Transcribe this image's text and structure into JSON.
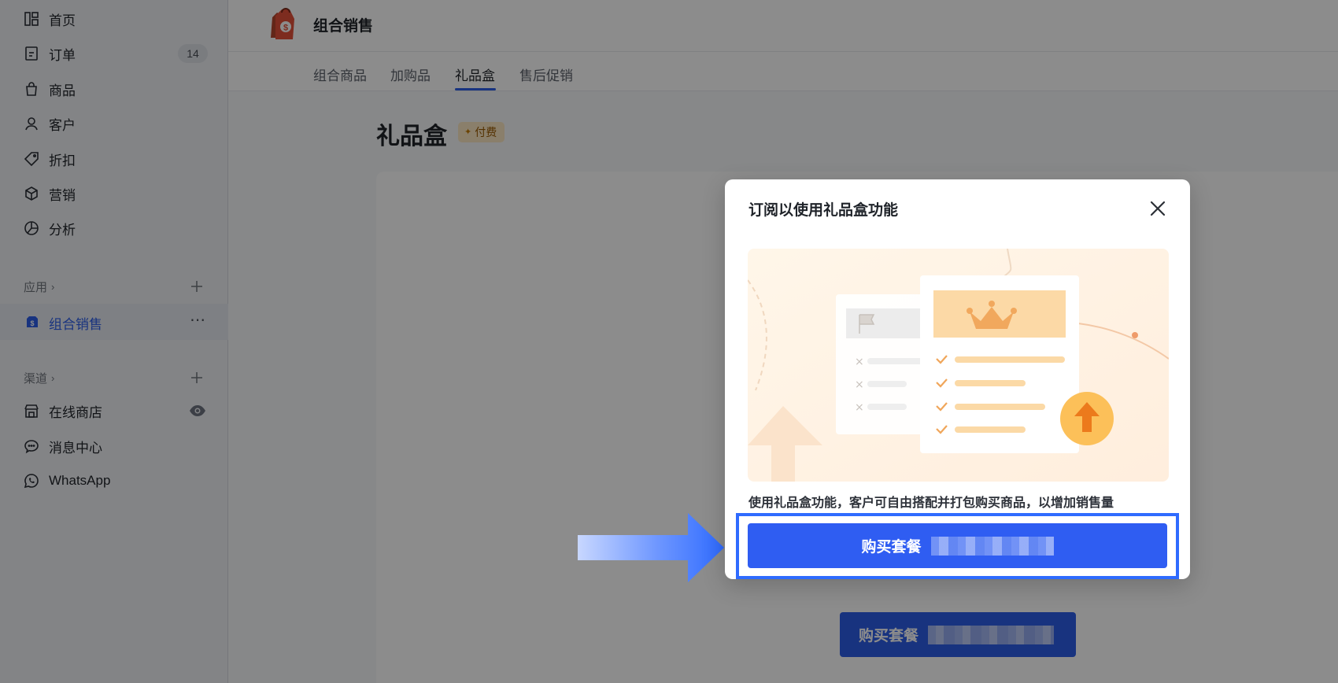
{
  "sidebar": {
    "items": [
      {
        "label": "首页",
        "icon": "home-icon"
      },
      {
        "label": "订单",
        "icon": "order-icon",
        "badge": "14"
      },
      {
        "label": "商品",
        "icon": "bag-icon"
      },
      {
        "label": "客户",
        "icon": "user-icon"
      },
      {
        "label": "折扣",
        "icon": "tag-icon"
      },
      {
        "label": "营销",
        "icon": "box-icon"
      },
      {
        "label": "分析",
        "icon": "chart-pie-icon"
      }
    ],
    "apps_label": "应用",
    "active_app": "组合销售",
    "channels_label": "渠道",
    "channels": [
      {
        "label": "在线商店",
        "icon": "store-icon"
      },
      {
        "label": "消息中心",
        "icon": "chat-icon"
      },
      {
        "label": "WhatsApp",
        "icon": "whatsapp-icon"
      }
    ]
  },
  "header": {
    "title": "组合销售"
  },
  "tabs": [
    {
      "label": "组合商品"
    },
    {
      "label": "加购品"
    },
    {
      "label": "礼品盒",
      "active": true
    },
    {
      "label": "售后促销"
    }
  ],
  "page": {
    "title": "礼品盒",
    "paid_badge": "付费",
    "buy_label": "购买套餐"
  },
  "modal": {
    "title": "订阅以使用礼品盒功能",
    "description": "使用礼品盒功能，客户可自由搭配并打包购买商品，以增加销售量",
    "buy_label": "购买套餐"
  },
  "colors": {
    "accent": "#2f5df2",
    "highlight_border": "#2f6bff",
    "paid_badge_bg": "#fce8c4",
    "illustration_bg": "#fff2e0"
  }
}
